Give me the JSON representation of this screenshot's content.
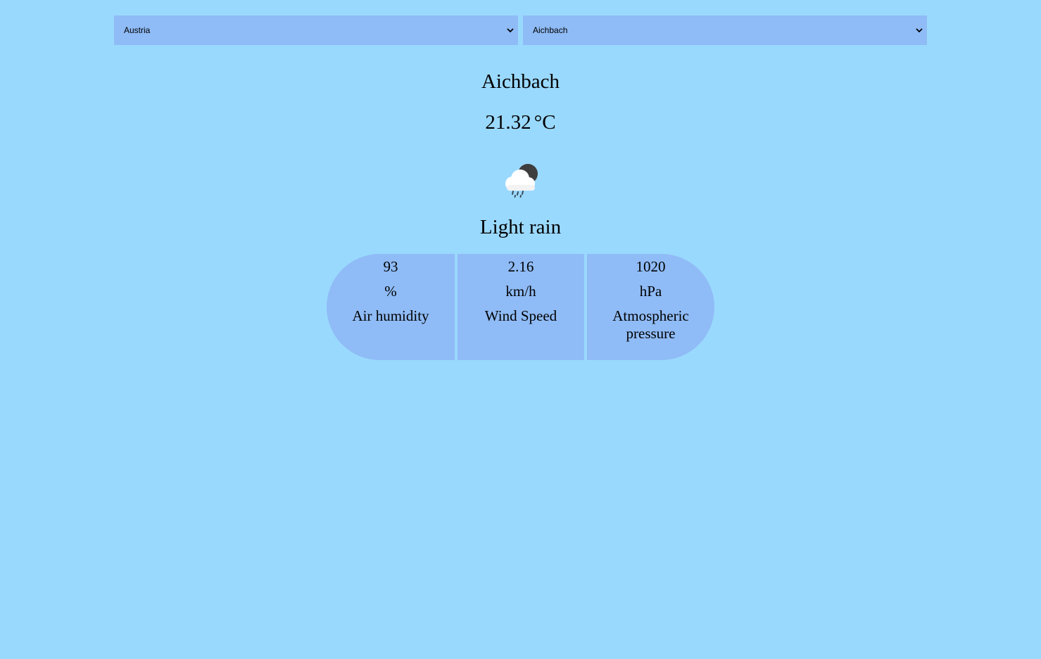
{
  "selectors": {
    "country": {
      "value": "Austria"
    },
    "city": {
      "value": "Aichbach"
    }
  },
  "weather": {
    "city": "Aichbach",
    "temperature": "21.32",
    "temperature_unit": "°C",
    "icon": "rain-cloud-moon-icon",
    "condition": "Light rain"
  },
  "stats": {
    "humidity": {
      "value": "93",
      "unit": "%",
      "label": "Air humidity"
    },
    "wind": {
      "value": "2.16",
      "unit": "km/h",
      "label": "Wind Speed"
    },
    "pressure": {
      "value": "1020",
      "unit": "hPa",
      "label": "Atmospheric pressure"
    }
  },
  "colors": {
    "background": "#9ad9fe",
    "panel": "#8fbbf6"
  }
}
